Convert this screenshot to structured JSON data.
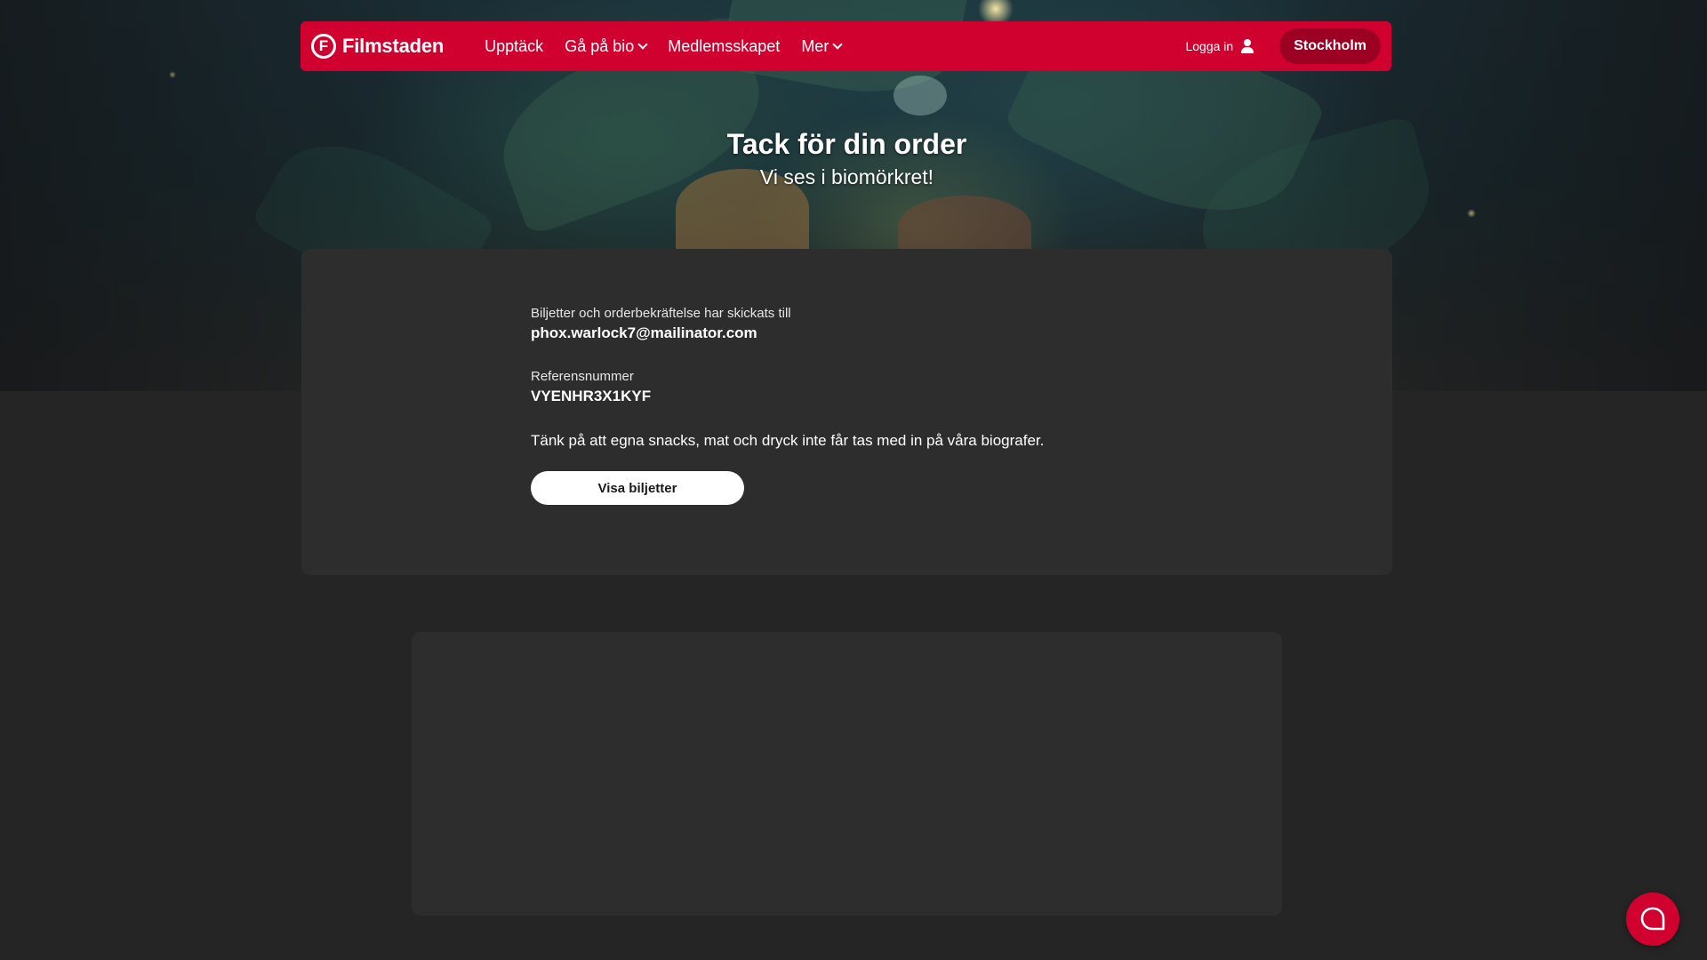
{
  "header": {
    "logo_letter": "F",
    "logo_text": "Filmstaden",
    "nav": {
      "discover": "Upptäck",
      "go_to_cinema": "Gå på bio",
      "membership": "Medlemsskapet",
      "more": "Mer"
    },
    "login_label": "Logga in",
    "city": "Stockholm"
  },
  "hero": {
    "title": "Tack för din order",
    "subtitle": "Vi ses i biomörkret!"
  },
  "confirmation": {
    "sent_to_label": "Biljetter och orderbekräftelse har skickats till",
    "email": "phox.warlock7@mailinator.com",
    "reference_label": "Referensnummer",
    "reference_number": "VYENHR3X1KYF",
    "notice": "Tänk på att egna snacks, mat och dryck inte får tas med in på våra biografer.",
    "view_tickets_button": "Visa biljetter"
  },
  "icons": {
    "chat": "chat-bubble-icon",
    "user": "user-icon",
    "chevron": "chevron-down-icon"
  },
  "colors": {
    "brand_red": "#d0002f",
    "city_button": "#9c0022",
    "page_background": "#252525",
    "card_background": "#2d2d2d"
  }
}
